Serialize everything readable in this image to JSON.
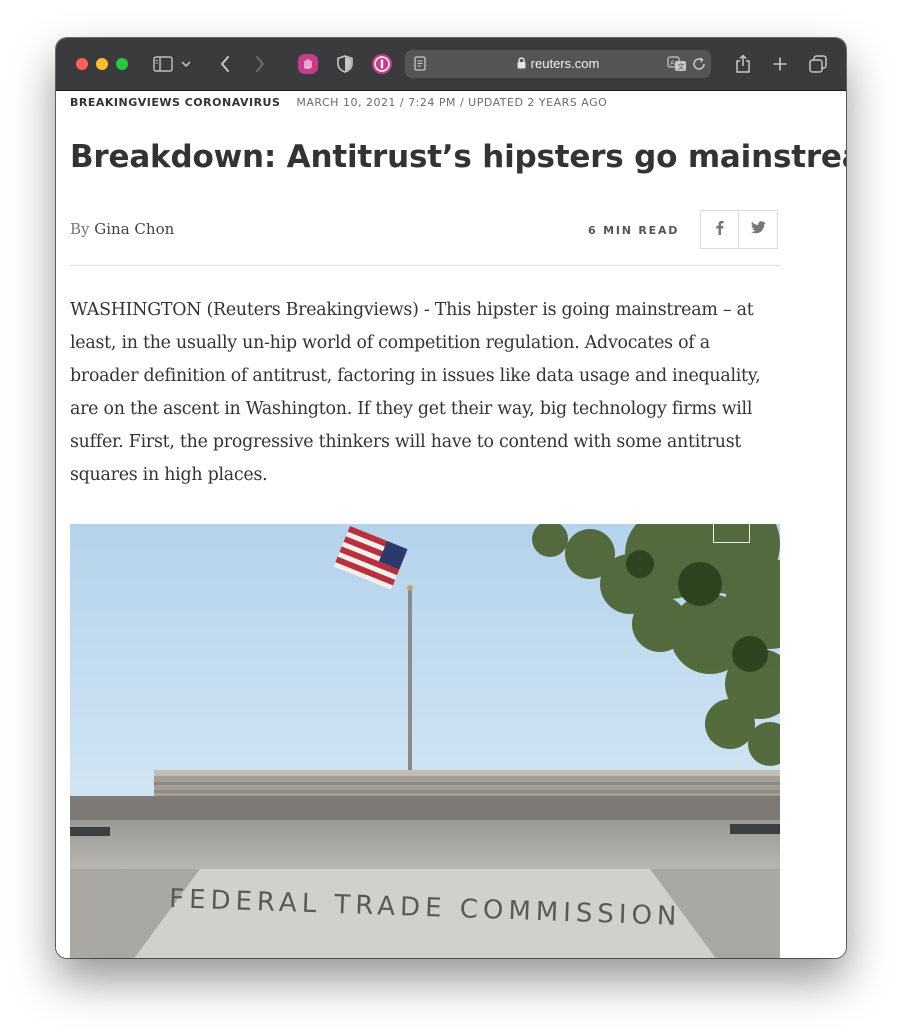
{
  "browser": {
    "domain": "reuters.com",
    "icons": [
      "sidebar-icon",
      "chevron-down-icon",
      "back-icon",
      "forward-icon",
      "extension-hand-icon",
      "shield-icon",
      "password-manager-icon",
      "reader-icon",
      "lock-icon",
      "translate-icon",
      "reload-icon",
      "share-icon",
      "new-tab-icon",
      "tabs-overview-icon"
    ]
  },
  "article": {
    "section": "BREAKINGVIEWS CORONAVIRUS",
    "date": "MARCH 10, 2021 / 7:24 PM / UPDATED 2 YEARS AGO",
    "title": "Breakdown: Antitrust’s hipsters go mainstream",
    "byline_prefix": "By",
    "author": "Gina Chon",
    "read_time": "6 MIN READ",
    "body": "WASHINGTON (Reuters Breakingviews) - This hipster is going mainstream – at least, in the usually un-hip world of competition regulation. Advocates of a broader definition of antitrust, factoring in issues like data usage and inequality, are on the ascent in Washington. If they get their way, big technology firms will suffer. First, the progressive thinkers will have to contend with some antitrust squares in high places.",
    "image_inscription": "FEDERAL TRADE COMMISSION"
  },
  "colors": {
    "toolbar": "#3b3b3d",
    "address_bar": "#545456",
    "title_text": "#333333",
    "sky": "#c9e2f4",
    "ext_hand": "#c83b8a",
    "ext_password": "#c83b8a"
  }
}
